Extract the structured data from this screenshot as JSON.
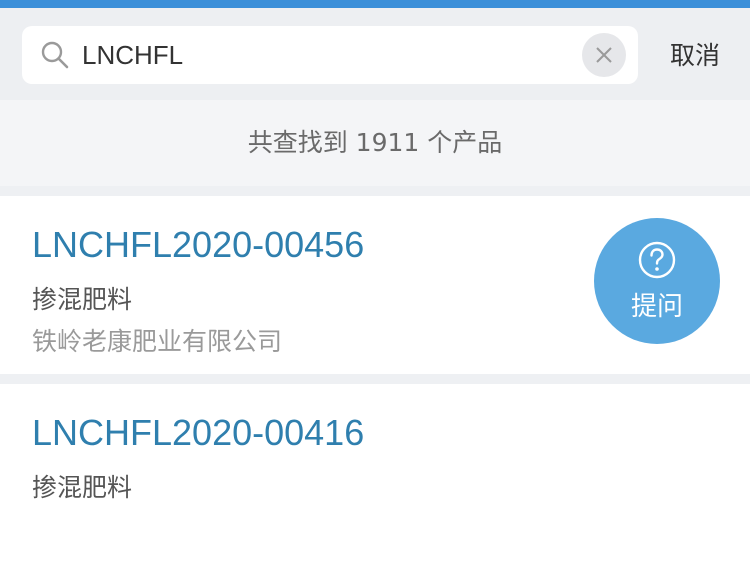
{
  "search": {
    "value": "LNCHFL",
    "cancel_label": "取消"
  },
  "results": {
    "count_text": "共查找到 1911 个产品",
    "items": [
      {
        "code": "LNCHFL2020-00456",
        "type": "掺混肥料",
        "company": "铁岭老康肥业有限公司"
      },
      {
        "code": "LNCHFL2020-00416",
        "type": "掺混肥料",
        "company": ""
      }
    ]
  },
  "ask_button": {
    "label": "提问"
  },
  "colors": {
    "accent": "#3b8fd9",
    "link": "#2f7fae",
    "ask_button": "#5aa9e0"
  }
}
